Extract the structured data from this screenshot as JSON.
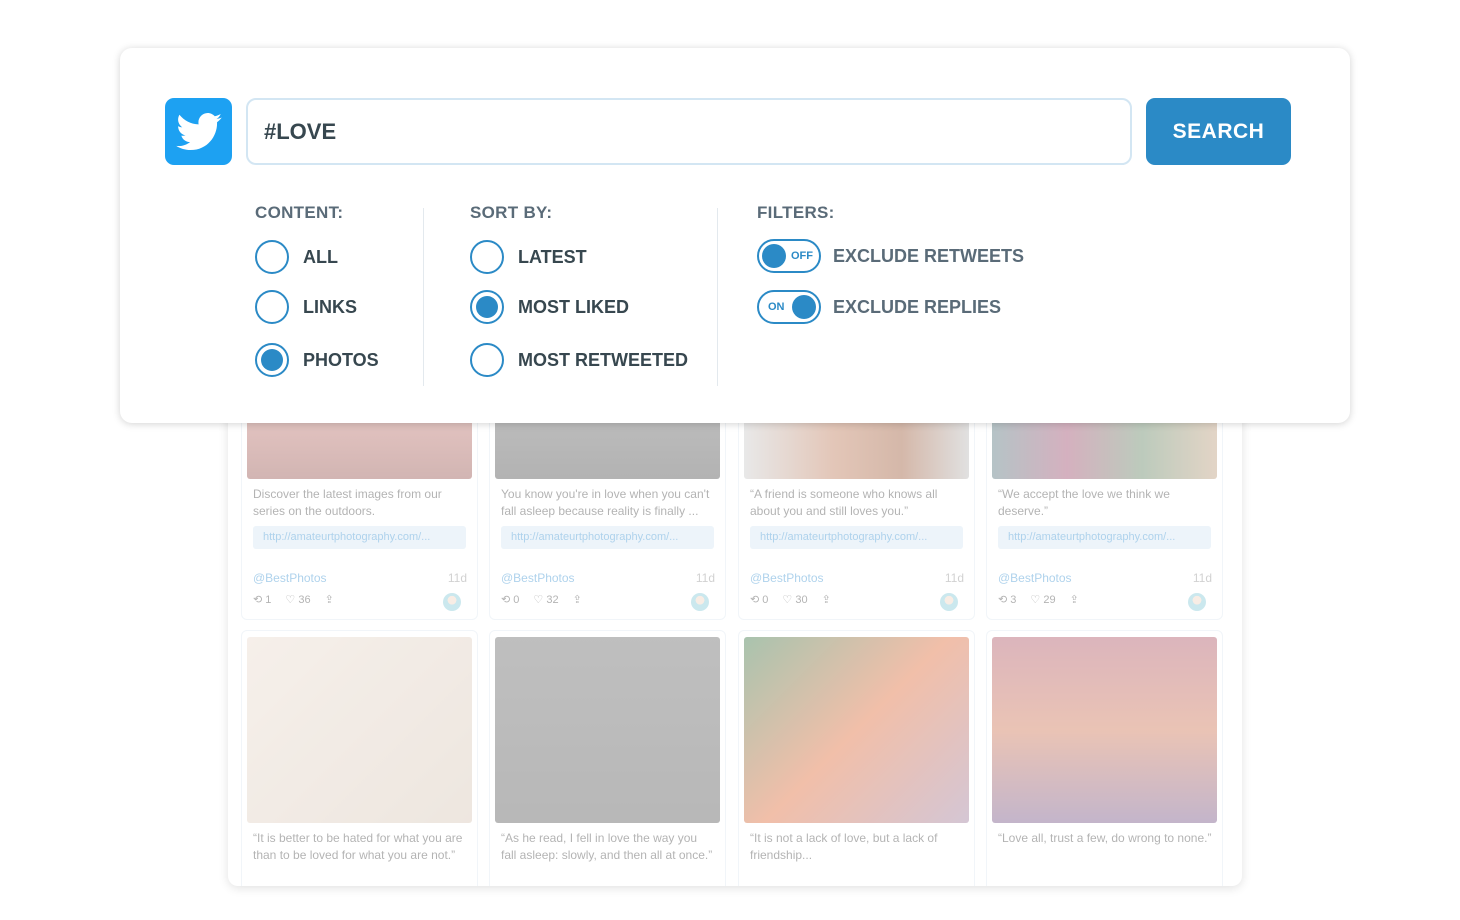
{
  "search": {
    "value": "#LOVE",
    "button": "SEARCH"
  },
  "content": {
    "title": "CONTENT:",
    "options": [
      {
        "label": "ALL",
        "selected": false
      },
      {
        "label": "LINKS",
        "selected": false
      },
      {
        "label": "PHOTOS",
        "selected": true
      }
    ]
  },
  "sort": {
    "title": "SORT BY:",
    "options": [
      {
        "label": "LATEST",
        "selected": false
      },
      {
        "label": "MOST LIKED",
        "selected": true
      },
      {
        "label": "MOST RETWEETED",
        "selected": false
      }
    ]
  },
  "filters": {
    "title": "FILTERS:",
    "items": [
      {
        "label": "EXCLUDE RETWEETS",
        "state": "OFF"
      },
      {
        "label": "EXCLUDE REPLIES",
        "state": "ON"
      }
    ]
  },
  "colors": {
    "accent": "#2b8ac6",
    "twitter": "#1da1f2"
  },
  "tweets": [
    {
      "text": "Discover the latest images from our series on the outdoors.",
      "link": "http://amateurtphotography.com/...",
      "user": "@BestPhotos",
      "age": "11d",
      "retweets": "1",
      "likes": "36"
    },
    {
      "text": "You know you're in love when you can't fall asleep because reality is finally ...",
      "link": "http://amateurtphotography.com/...",
      "user": "@BestPhotos",
      "age": "11d",
      "retweets": "0",
      "likes": "32"
    },
    {
      "text": "“A friend is someone who knows all about you and still loves you.”",
      "link": "http://amateurtphotography.com/...",
      "user": "@BestPhotos",
      "age": "11d",
      "retweets": "0",
      "likes": "30"
    },
    {
      "text": "“We accept the love we think we deserve.”",
      "link": "http://amateurtphotography.com/...",
      "user": "@BestPhotos",
      "age": "11d",
      "retweets": "3",
      "likes": "29"
    },
    {
      "text": "“It is better to be hated for what you are than to be loved for what you are not.”"
    },
    {
      "text": "“As he read, I fell in love the way you fall asleep: slowly, and then all at once.”"
    },
    {
      "text": "“It is not a lack of love, but a lack of friendship..."
    },
    {
      "text": "“Love all, trust a few, do wrong to none.”"
    }
  ]
}
